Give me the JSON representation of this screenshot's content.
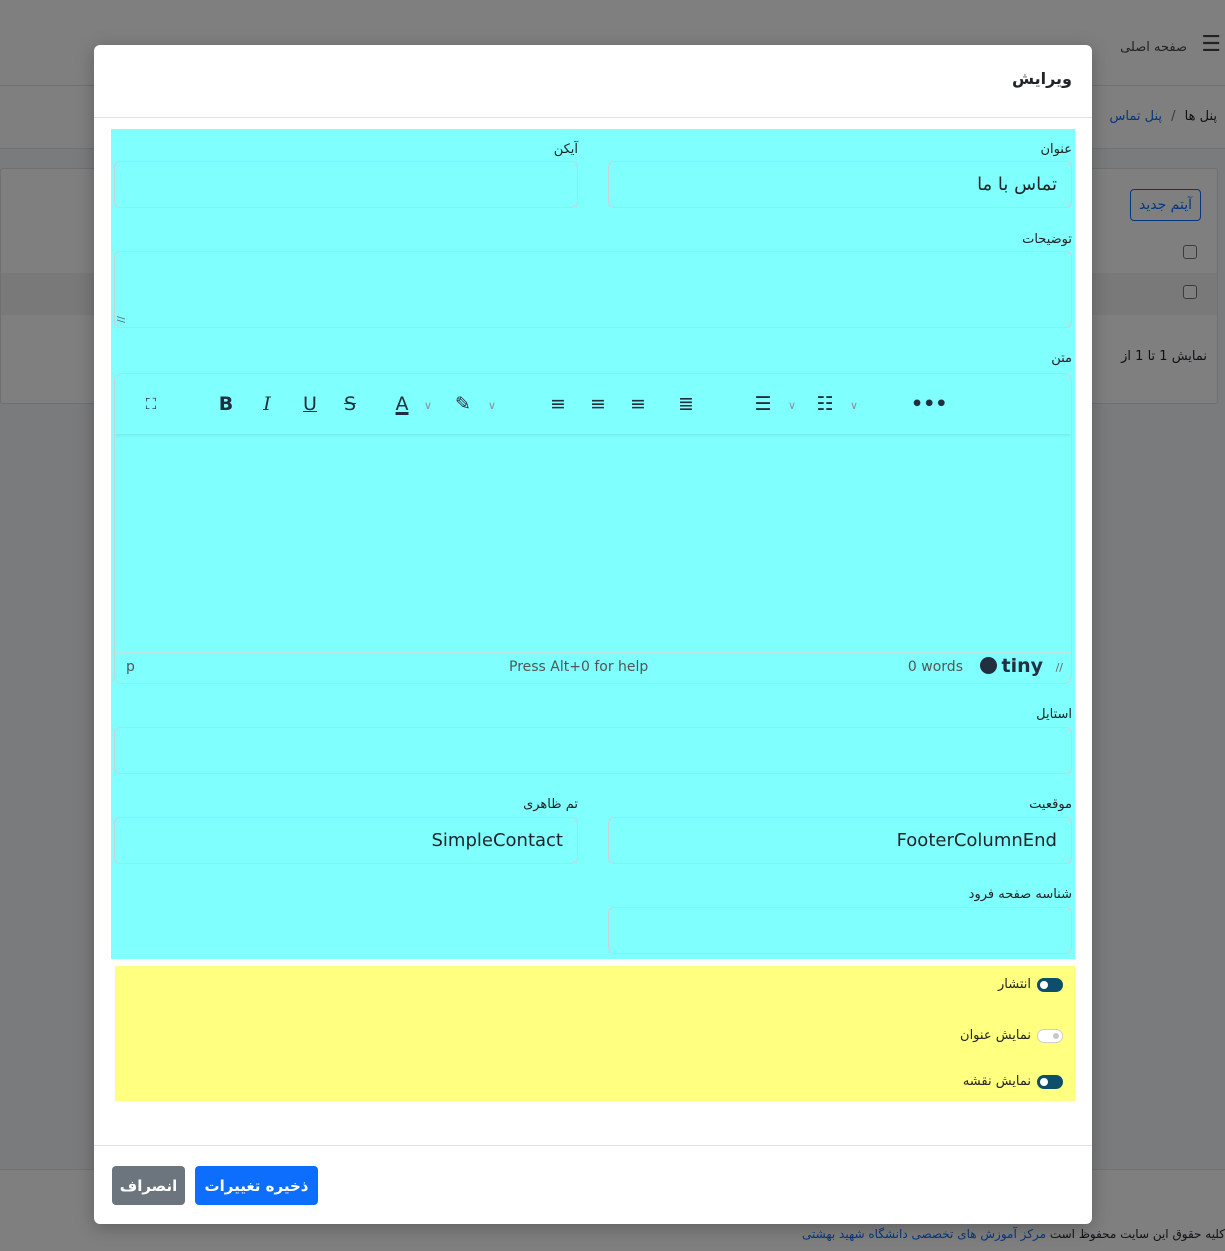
{
  "background": {
    "home_label": "صفحه اصلی",
    "breadcrumb": {
      "panels": "پنل ها",
      "separator": "/",
      "current": "پنل تماس"
    },
    "new_item_button": "آیتم جدید",
    "showing_text": "نمایش 1 تا 1 از",
    "footer": {
      "copyright_prefix": "کلیه حقوق این سایت محفوظ است",
      "org_link": "مرکز آموزش های تخصصی دانشگاه شهید بهشتی"
    }
  },
  "modal": {
    "title": "ویرایش",
    "fields": {
      "title": {
        "label": "عنوان",
        "value": "تماس با ما"
      },
      "icon": {
        "label": "آیکن",
        "value": ""
      },
      "description": {
        "label": "توضیحات",
        "value": ""
      },
      "text": {
        "label": "متن"
      },
      "style": {
        "label": "استایل",
        "value": ""
      },
      "position": {
        "label": "موقعیت",
        "value": "FooterColumnEnd"
      },
      "theme": {
        "label": "تم ظاهری",
        "value": "SimpleContact"
      },
      "landing_page_id": {
        "label": "شناسه صفحه فرود",
        "value": ""
      }
    },
    "editor": {
      "toolbar_icons": [
        "fullscreen-icon",
        "bold-icon",
        "italic-icon",
        "underline-icon",
        "strikethrough-icon",
        "text-color-icon",
        "highlight-icon",
        "align-left-icon",
        "align-center-icon",
        "align-right-icon",
        "align-justify-icon",
        "bullet-list-icon",
        "numbered-list-icon",
        "more-icon"
      ],
      "status_path": "p",
      "help_text": "Press Alt+0 for help",
      "word_count": "0 words",
      "brand": "tiny"
    },
    "switches": [
      {
        "label": "انتشار",
        "on": true
      },
      {
        "label": "نمایش عنوان",
        "on": false
      },
      {
        "label": "نمایش نقشه",
        "on": true
      }
    ],
    "buttons": {
      "save": "ذخیره تغییرات",
      "cancel": "انصراف"
    }
  },
  "colors": {
    "form_highlight": "#80ffff",
    "switch_highlight": "#ffff80",
    "primary": "#0d6efd",
    "secondary": "#6c757d"
  }
}
